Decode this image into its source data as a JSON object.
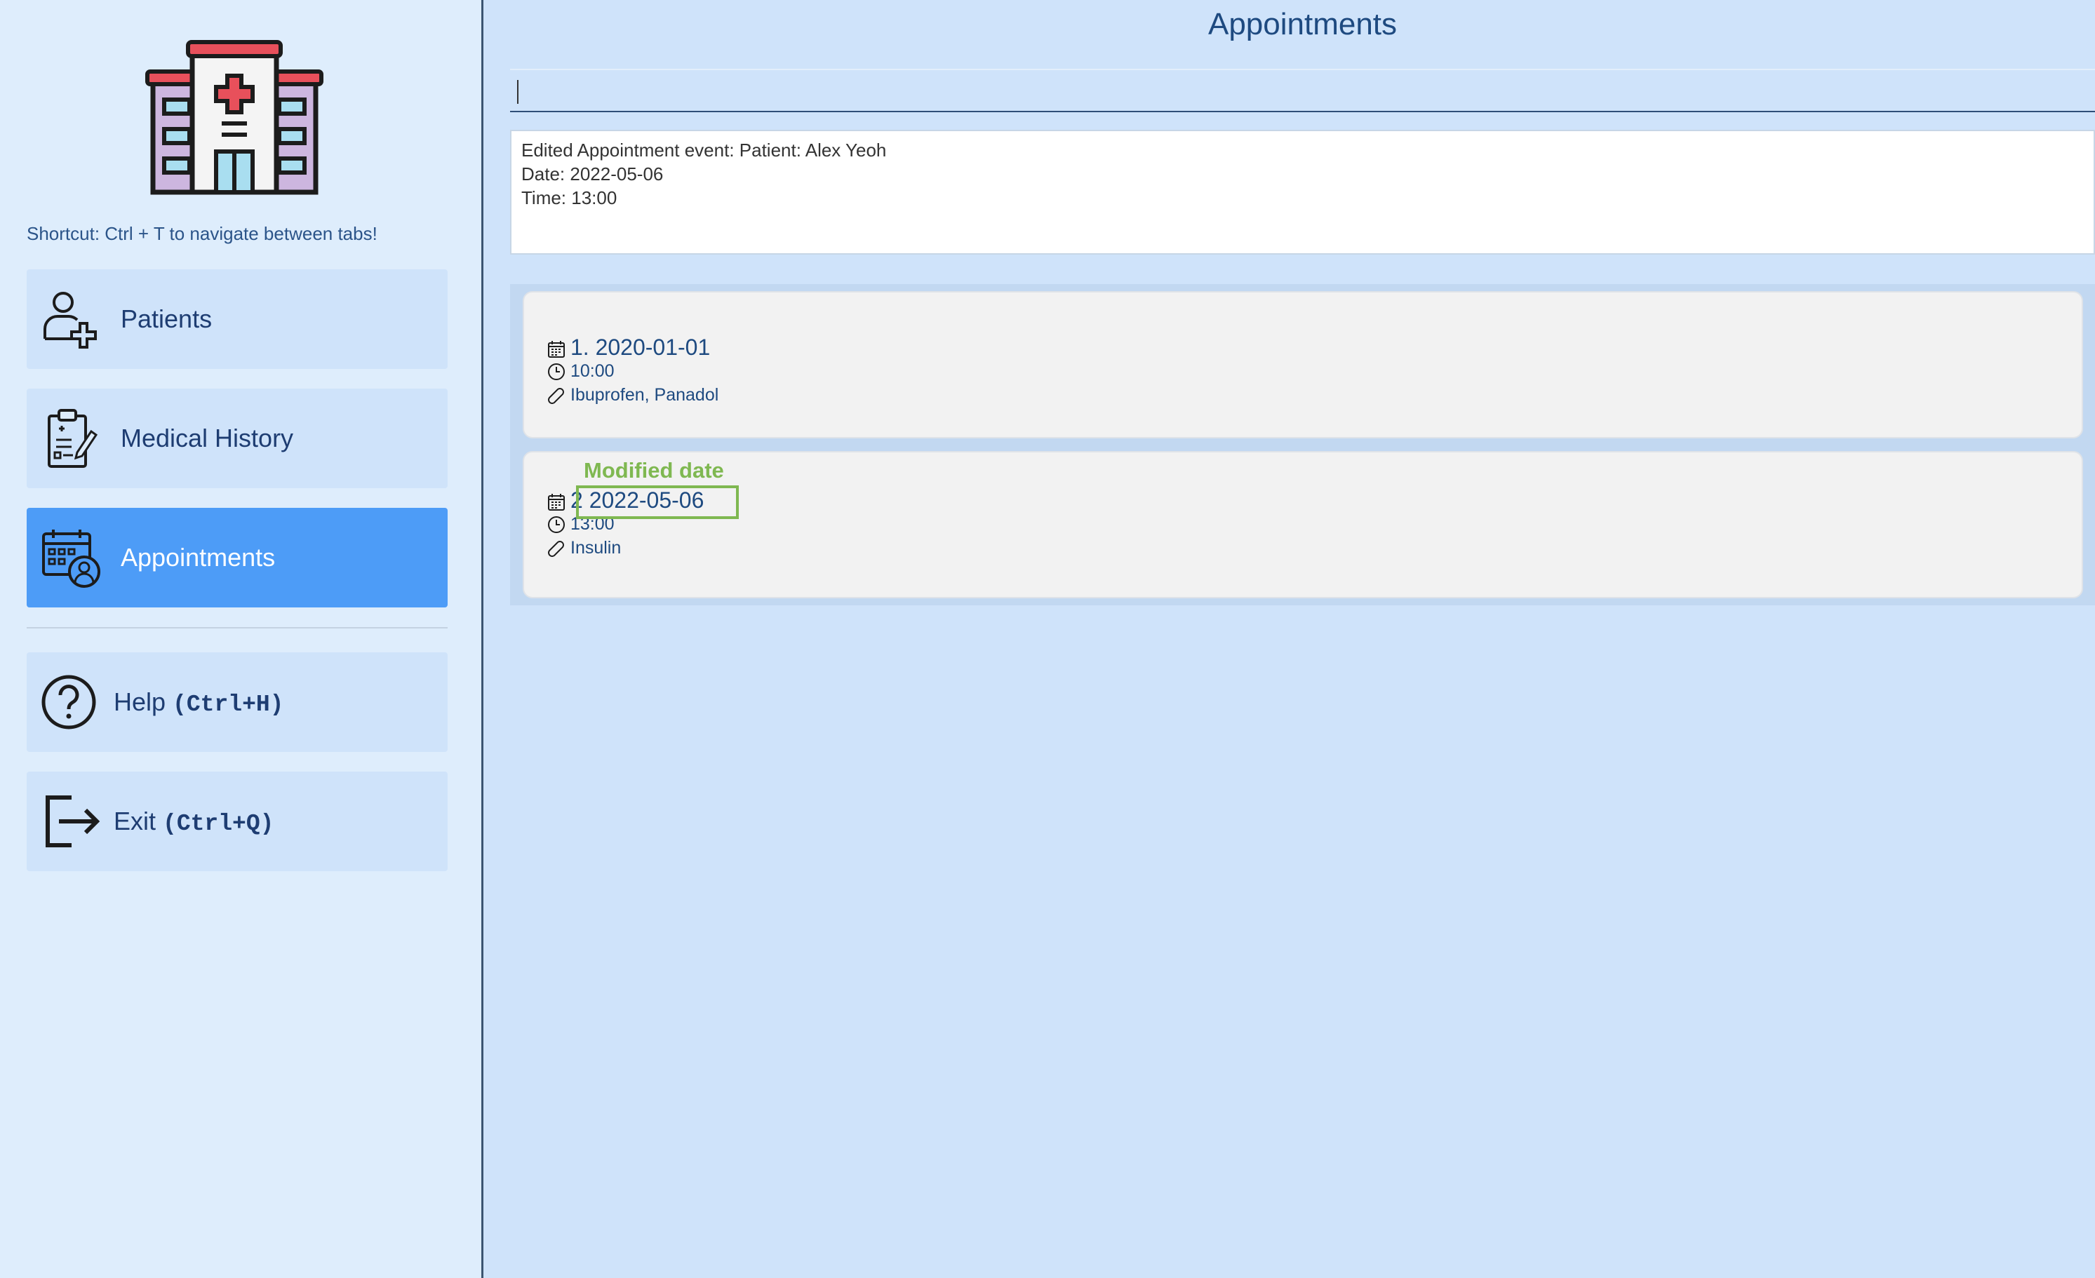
{
  "sidebar": {
    "logo_icon": "hospital-icon",
    "shortcut_hint": "Shortcut: Ctrl + T to navigate between tabs!",
    "items": [
      {
        "label": "Patients",
        "icon": "add-patient-icon"
      },
      {
        "label": "Medical History",
        "icon": "clipboard-icon"
      },
      {
        "label": "Appointments",
        "icon": "calendar-doctor-icon",
        "active": true
      }
    ],
    "help": {
      "label": "Help",
      "shortcut": "(Ctrl+H)",
      "icon": "question-icon"
    },
    "exit": {
      "label": "Exit",
      "shortcut": "(Ctrl+Q)",
      "icon": "exit-icon"
    }
  },
  "main": {
    "title": "Appointments",
    "command_input": {
      "value": ""
    },
    "result": {
      "lines": [
        "Edited Appointment event: Patient: Alex Yeoh",
        "Date: 2022-05-06",
        "Time: 13:00"
      ]
    },
    "appointments": [
      {
        "index": "1.",
        "date": "2020-01-01",
        "time": "10:00",
        "medication": "Ibuprofen, Panadol"
      },
      {
        "index": "2",
        "date": "2022-05-06",
        "time": "13:00",
        "medication": "Insulin"
      }
    ],
    "annotation": {
      "label": "Modified date",
      "color": "#7fb851"
    }
  },
  "colors": {
    "accent": "#4d9cf7",
    "background": "#cfe3fa",
    "sidebar": "#deedfc",
    "text": "#1e3d72"
  }
}
